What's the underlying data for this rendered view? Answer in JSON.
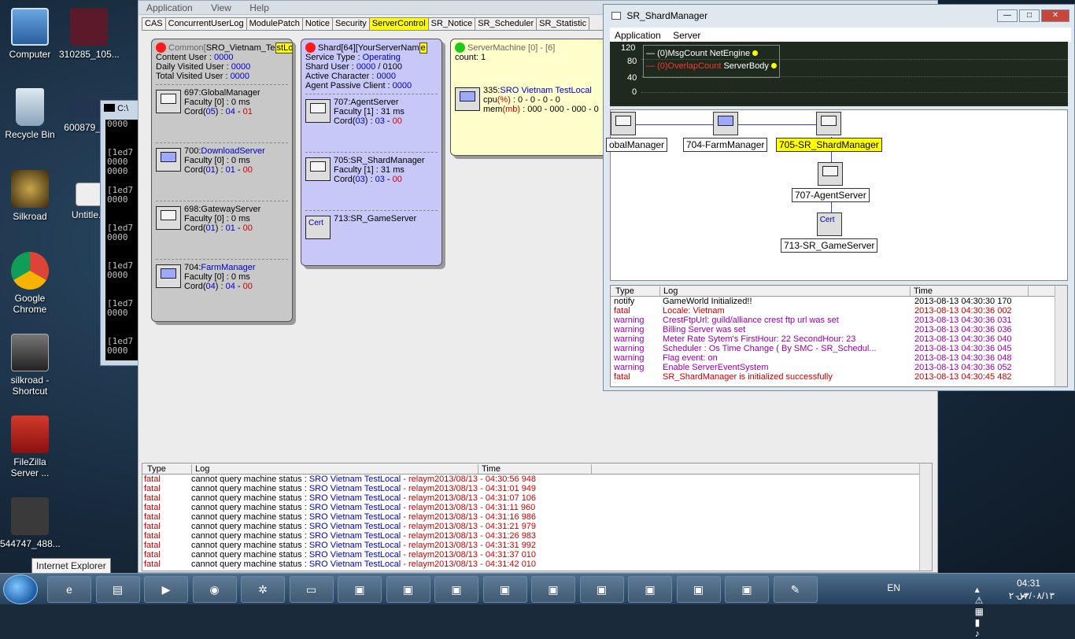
{
  "desktop": {
    "icons": [
      {
        "label": "Computer",
        "color": "#3b7bbf"
      },
      {
        "label": "310285_105...",
        "color": "#6a2030"
      },
      {
        "label": "Recycle Bin",
        "color": "#9fb7cc"
      },
      {
        "label": "600879_3...",
        "color": "#2a3a5a"
      },
      {
        "label": "Silkroad",
        "color": "#7a6a3a"
      },
      {
        "label": "Untitle...",
        "color": "#dddddd"
      },
      {
        "label": "Google Chrome",
        "color": "#e04030"
      },
      {
        "label": "silkroad - Shortcut",
        "color": "#555555"
      },
      {
        "label": "FileZilla Server ...",
        "color": "#b02020"
      },
      {
        "label": "544747_488...",
        "color": "#444444"
      }
    ],
    "tooltip": "Internet Explorer"
  },
  "console": {
    "title": "C:\\",
    "lines": [
      "0000",
      "",
      "",
      "[1ed7",
      "0000",
      "0000",
      "",
      "[1ed7",
      "0000",
      "",
      "",
      "[1ed7",
      "0000",
      "",
      "",
      "[1ed7",
      "0000",
      "",
      "",
      "[1ed7",
      "0000",
      "",
      "",
      "[1ed7",
      "0000"
    ]
  },
  "main": {
    "menu": [
      "Application",
      "View",
      "Help"
    ],
    "tabs": [
      "CAS",
      "ConcurrentUserLog",
      "ModulePatch",
      "Notice",
      "Security",
      "ServerControl",
      "SR_Notice",
      "SR_Scheduler",
      "SR_Statistic"
    ],
    "active_tab": "ServerControl",
    "common": {
      "head_prefix": "Common[",
      "head_name": "SRO_Vietnam_Te",
      "head_hl": "stLo",
      "head_suffix": "c",
      "stats": [
        {
          "label": "Content User : ",
          "value": "0000"
        },
        {
          "label": "Daily Visited User : ",
          "value": "0000"
        },
        {
          "label": "Total Visited User : ",
          "value": "0000"
        }
      ],
      "servers": [
        {
          "id": "697:",
          "name": "GlobalManager",
          "name_blue": false,
          "faculty": "Faculty [0] : 0 ms",
          "cord_a": "05",
          "cord_b": "04",
          "cord_c": "01",
          "blue_screen": false
        },
        {
          "id": "700:",
          "name": "DownloadServer",
          "name_blue": true,
          "faculty": "Faculty [0] : 0 ms",
          "cord_a": "01",
          "cord_b": "01",
          "cord_c": "00",
          "blue_screen": true
        },
        {
          "id": "698:",
          "name": "GatewayServer",
          "name_blue": false,
          "faculty": "Faculty [0] : 0 ms",
          "cord_a": "01",
          "cord_b": "01",
          "cord_c": "00",
          "blue_screen": false
        },
        {
          "id": "704:",
          "name": "FarmManager",
          "name_blue": true,
          "faculty": "Faculty [0] : 0 ms",
          "cord_a": "04",
          "cord_b": "04",
          "cord_c": "00",
          "blue_screen": true
        }
      ]
    },
    "shard": {
      "head_prefix": "Shard[64][YourServerNam",
      "head_hl": "e",
      "service_label": "Service Type : ",
      "service_value": "Operating",
      "shard_user_label": "Shard User : ",
      "shard_user_value": "0000",
      "shard_user_max": " / 0100",
      "active_label": "Active Character : ",
      "active_value": "0000",
      "passive_label": "Agent Passive Client : ",
      "passive_value": "0000",
      "servers": [
        {
          "id": "707:",
          "name": "AgentServer",
          "faculty": "Faculty [1] : 31 ms",
          "cord_a": "03",
          "cord_b": "03",
          "cord_c": "00"
        },
        {
          "id": "705:",
          "name": "SR_ShardManager",
          "faculty": "Faculty [1] : 31 ms",
          "cord_a": "03",
          "cord_b": "03",
          "cord_c": "00"
        }
      ],
      "game": {
        "cert": "Cert",
        "label": "713:SR_GameServer"
      }
    },
    "machine": {
      "head": "ServerMachine [0] - [6]",
      "count": "count: 1",
      "id": "335:",
      "name": "SRO Vietnam TestLocal",
      "cpu_label": "cpu",
      "cpu_unit": "(%)",
      "cpu_values": " : 0 - 0 - 0 - 0",
      "mem_label": "mem",
      "mem_unit": "(mb)",
      "mem_values": " : 000 - 000 - 000 - 0"
    },
    "log": {
      "headers": [
        "Type",
        "Log",
        "Time"
      ],
      "rows": [
        {
          "type": "fatal",
          "msg": "cannot query machine status : ",
          "machine": "SRO Vietnam TestLocal",
          "tail": " - relaym",
          "time": "2013/08/13 - 04:30:56 948"
        },
        {
          "type": "fatal",
          "msg": "cannot query machine status : ",
          "machine": "SRO Vietnam TestLocal",
          "tail": " - relaym",
          "time": "2013/08/13 - 04:31:01 949"
        },
        {
          "type": "fatal",
          "msg": "cannot query machine status : ",
          "machine": "SRO Vietnam TestLocal",
          "tail": " - relaym",
          "time": "2013/08/13 - 04:31:07 106"
        },
        {
          "type": "fatal",
          "msg": "cannot query machine status : ",
          "machine": "SRO Vietnam TestLocal",
          "tail": " - relaym",
          "time": "2013/08/13 - 04:31:11 960"
        },
        {
          "type": "fatal",
          "msg": "cannot query machine status : ",
          "machine": "SRO Vietnam TestLocal",
          "tail": " - relaym",
          "time": "2013/08/13 - 04:31:16 986"
        },
        {
          "type": "fatal",
          "msg": "cannot query machine status : ",
          "machine": "SRO Vietnam TestLocal",
          "tail": " - relaym",
          "time": "2013/08/13 - 04:31:21 979"
        },
        {
          "type": "fatal",
          "msg": "cannot query machine status : ",
          "machine": "SRO Vietnam TestLocal",
          "tail": " - relaym",
          "time": "2013/08/13 - 04:31:26 983"
        },
        {
          "type": "fatal",
          "msg": "cannot query machine status : ",
          "machine": "SRO Vietnam TestLocal",
          "tail": " - relaym",
          "time": "2013/08/13 - 04:31:31 992"
        },
        {
          "type": "fatal",
          "msg": "cannot query machine status : ",
          "machine": "SRO Vietnam TestLocal",
          "tail": " - relaym",
          "time": "2013/08/13 - 04:31:37 010"
        },
        {
          "type": "fatal",
          "msg": "cannot query machine status : ",
          "machine": "SRO Vietnam TestLocal",
          "tail": " - relaym",
          "time": "2013/08/13 - 04:31:42 010"
        }
      ]
    }
  },
  "shard_window": {
    "title": "SR_ShardManager",
    "buttons": [
      "—",
      "□",
      "✕"
    ],
    "menu": [
      "Application",
      "Server"
    ],
    "graph": {
      "y_ticks": [
        "120",
        "80",
        "40",
        "0"
      ],
      "legend": [
        {
          "count": "(0)MsgCount",
          "name": "NetEngine",
          "color": "#ffffff"
        },
        {
          "count": "(0)OverlapCount",
          "name": "ServerBody",
          "color": "#ff3333"
        }
      ]
    },
    "nodes": [
      {
        "label": "obalManager",
        "selected": false,
        "screen": "grey"
      },
      {
        "label": "704-FarmManager",
        "selected": false,
        "screen": "blue"
      },
      {
        "label": "705-SR_ShardManager",
        "selected": true,
        "screen": "grey"
      },
      {
        "label": "707-AgentServer",
        "selected": false,
        "screen": "grey"
      },
      {
        "label": "713-SR_GameServer",
        "selected": false,
        "screen": "cert",
        "cert": "Cert"
      }
    ],
    "log": {
      "headers": [
        "Type",
        "Log",
        "Time"
      ],
      "rows": [
        {
          "type": "notify",
          "msg": "GameWorld Initialized!!",
          "time": "2013-08-13 04:30:30 170",
          "color": "#000000"
        },
        {
          "type": "fatal",
          "msg": "Locale: Vietnam",
          "time": "2013-08-13 04:30:36 002",
          "color": "#cc0000"
        },
        {
          "type": "warning",
          "msg": "CrestFtpUrl: guild/alliance crest ftp url was set",
          "time": "2013-08-13 04:30:36 031",
          "color": "#9900aa"
        },
        {
          "type": "warning",
          "msg": "Billing Server was set",
          "time": "2013-08-13 04:30:36 036",
          "color": "#9900aa"
        },
        {
          "type": "warning",
          "msg": "Meter Rate Sytem's FirstHour: 22 SecondHour: 23",
          "time": "2013-08-13 04:30:36 040",
          "color": "#9900aa"
        },
        {
          "type": "warning",
          "msg": "Scheduler : Os Time Change ( By SMC - SR_Schedul...",
          "time": "2013-08-13 04:30:36 045",
          "color": "#9900aa"
        },
        {
          "type": "warning",
          "msg": "Flag event: on",
          "time": "2013-08-13 04:30:36 048",
          "color": "#9900aa"
        },
        {
          "type": "warning",
          "msg": "Enable ServerEventSystem",
          "time": "2013-08-13 04:30:36 052",
          "color": "#9900aa"
        },
        {
          "type": "fatal",
          "msg": "SR_ShardManager is initialized successfully",
          "time": "2013-08-13 04:30:45 482",
          "color": "#cc0000"
        }
      ]
    }
  },
  "taskbar": {
    "items": [
      "windows-explorer",
      "internet-explorer",
      "file-explorer",
      "media-player",
      "chrome",
      "app",
      "cmd",
      "app1",
      "app2",
      "app3",
      "app4",
      "app5",
      "app6",
      "app7",
      "app8",
      "app9",
      "paint"
    ],
    "lang": "EN",
    "time": "04:31 ص",
    "date": "٢٠١٣/٠٨/١٣"
  }
}
